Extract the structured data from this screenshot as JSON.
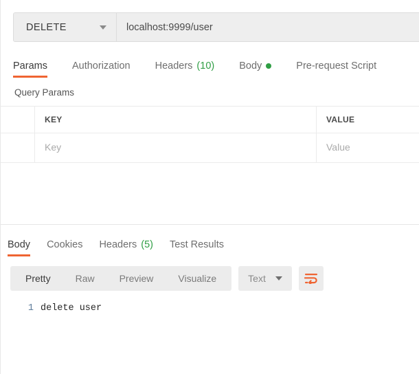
{
  "request": {
    "method": "DELETE",
    "url": "localhost:9999/user",
    "method_caret_icon": "chevron-down-icon",
    "tabs": [
      {
        "label": "Params",
        "active": true,
        "count": null,
        "dot": false
      },
      {
        "label": "Authorization",
        "active": false,
        "count": null,
        "dot": false
      },
      {
        "label": "Headers",
        "active": false,
        "count": "(10)",
        "dot": false
      },
      {
        "label": "Body",
        "active": false,
        "count": null,
        "dot": true
      },
      {
        "label": "Pre-request Script",
        "active": false,
        "count": null,
        "dot": false
      }
    ],
    "query_params": {
      "title": "Query Params",
      "columns": [
        "KEY",
        "VALUE"
      ],
      "rows": [
        {
          "key_placeholder": "Key",
          "value_placeholder": "Value"
        }
      ]
    }
  },
  "response": {
    "tabs": [
      {
        "label": "Body",
        "active": true,
        "count": null
      },
      {
        "label": "Cookies",
        "active": false,
        "count": null
      },
      {
        "label": "Headers",
        "active": false,
        "count": "(5)"
      },
      {
        "label": "Test Results",
        "active": false,
        "count": null
      }
    ],
    "view_modes": [
      {
        "label": "Pretty",
        "active": true
      },
      {
        "label": "Raw",
        "active": false
      },
      {
        "label": "Preview",
        "active": false
      },
      {
        "label": "Visualize",
        "active": false
      }
    ],
    "language": "Text",
    "language_caret_icon": "chevron-down-icon",
    "wrap_icon": "word-wrap-icon",
    "code": {
      "lines": [
        {
          "number": "1",
          "text": "delete user"
        }
      ]
    }
  },
  "colors": {
    "accent": "#ef6432",
    "green": "#2f9e44",
    "field_bg": "#eeeeee",
    "segment_bg": "#ececec",
    "text_dark": "#3b3b3b",
    "text_muted": "#6e6e6e",
    "placeholder": "#aaaaaa",
    "border": "#ebebeb",
    "line_number": "#5c7a99"
  }
}
